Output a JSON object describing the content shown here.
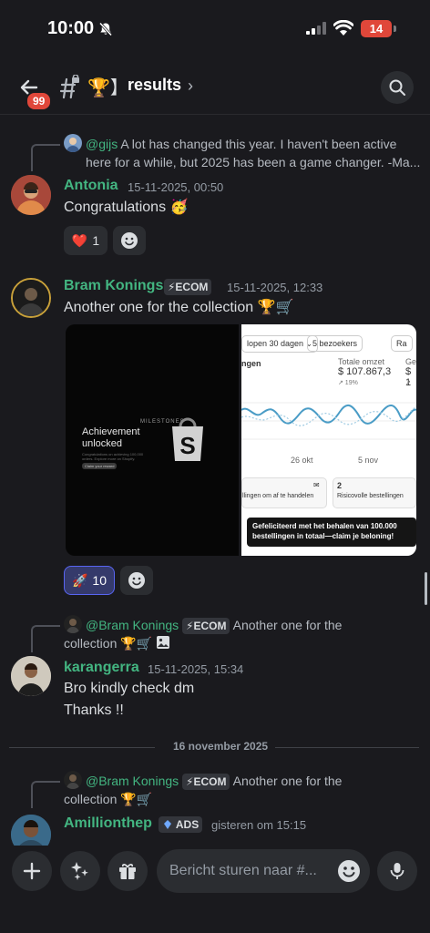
{
  "status_bar": {
    "time": "10:00",
    "battery": "14"
  },
  "header": {
    "unread_count": "99",
    "channel_emoji": "🏆】",
    "channel_name": "results",
    "chevron": "›"
  },
  "messages": [
    {
      "reply": {
        "user": "@gijs",
        "text": "A lot has changed this year.  I haven't been active here for a while, but 2025 has been a game changer. -Ma..."
      },
      "username": "Antonia",
      "username_color": "#43b581",
      "timestamp": "15-11-2025, 00:50",
      "text": "Congratulations 🥳",
      "reactions": [
        {
          "emoji": "❤️",
          "count": "1"
        }
      ]
    },
    {
      "username": "Bram Konings",
      "username_color": "#43b581",
      "tag": "⚡ECOM",
      "timestamp": "15-11-2025, 12:33",
      "text": "Another one for the collection 🏆🛒",
      "attachments": {
        "left": {
          "brand": "MILESTONES",
          "title": "Achievement unlocked",
          "body": "Congratulations on achieving 100,000 orders. Explore more on Shopify.",
          "button": "Claim your reward"
        },
        "right": {
          "filter_label": "lopen 30 dagen ⌄",
          "visitors": "5 bezoekers",
          "corner_label": "Ra",
          "section": "ngen",
          "metric_label": "Totale omzet",
          "metric_value": "$ 107.867,3",
          "metric_delta": "↗ 19%",
          "metric2_label": "Ge",
          "metric2_value": "$ 1",
          "metric2_delta": "↗",
          "date1": "26 okt",
          "date2": "5 nov",
          "orders_text": "llingen om af te handelen",
          "risk_count": "2",
          "risk_text": "Risicovolle bestellingen",
          "banner": "Gefeliciteerd met het behalen van 100.000 bestellingen in totaal—claim je beloning!"
        }
      },
      "reactions": [
        {
          "emoji": "🚀",
          "count": "10"
        }
      ]
    },
    {
      "reply": {
        "user": "@Bram Konings",
        "tag": "⚡ECOM",
        "text_line1": "Another one for the",
        "text_line2": "collection 🏆🛒"
      },
      "username": "karangerra",
      "username_color": "#43b581",
      "timestamp": "15-11-2025, 15:34",
      "lines": [
        "Bro kindly check dm",
        "Thanks !!"
      ]
    },
    {
      "reply": {
        "user": "@Bram Konings",
        "tag": "⚡ECOM",
        "text_line1": "Another one for the",
        "text_line2": "collection 🏆🛒"
      },
      "username": "Amillionthep",
      "username_color": "#43b581",
      "tag": "ADS",
      "timestamp": "gisteren om 15:15"
    }
  ],
  "date_divider": "16 november 2025",
  "composer": {
    "placeholder": "Bericht sturen naar #..."
  }
}
